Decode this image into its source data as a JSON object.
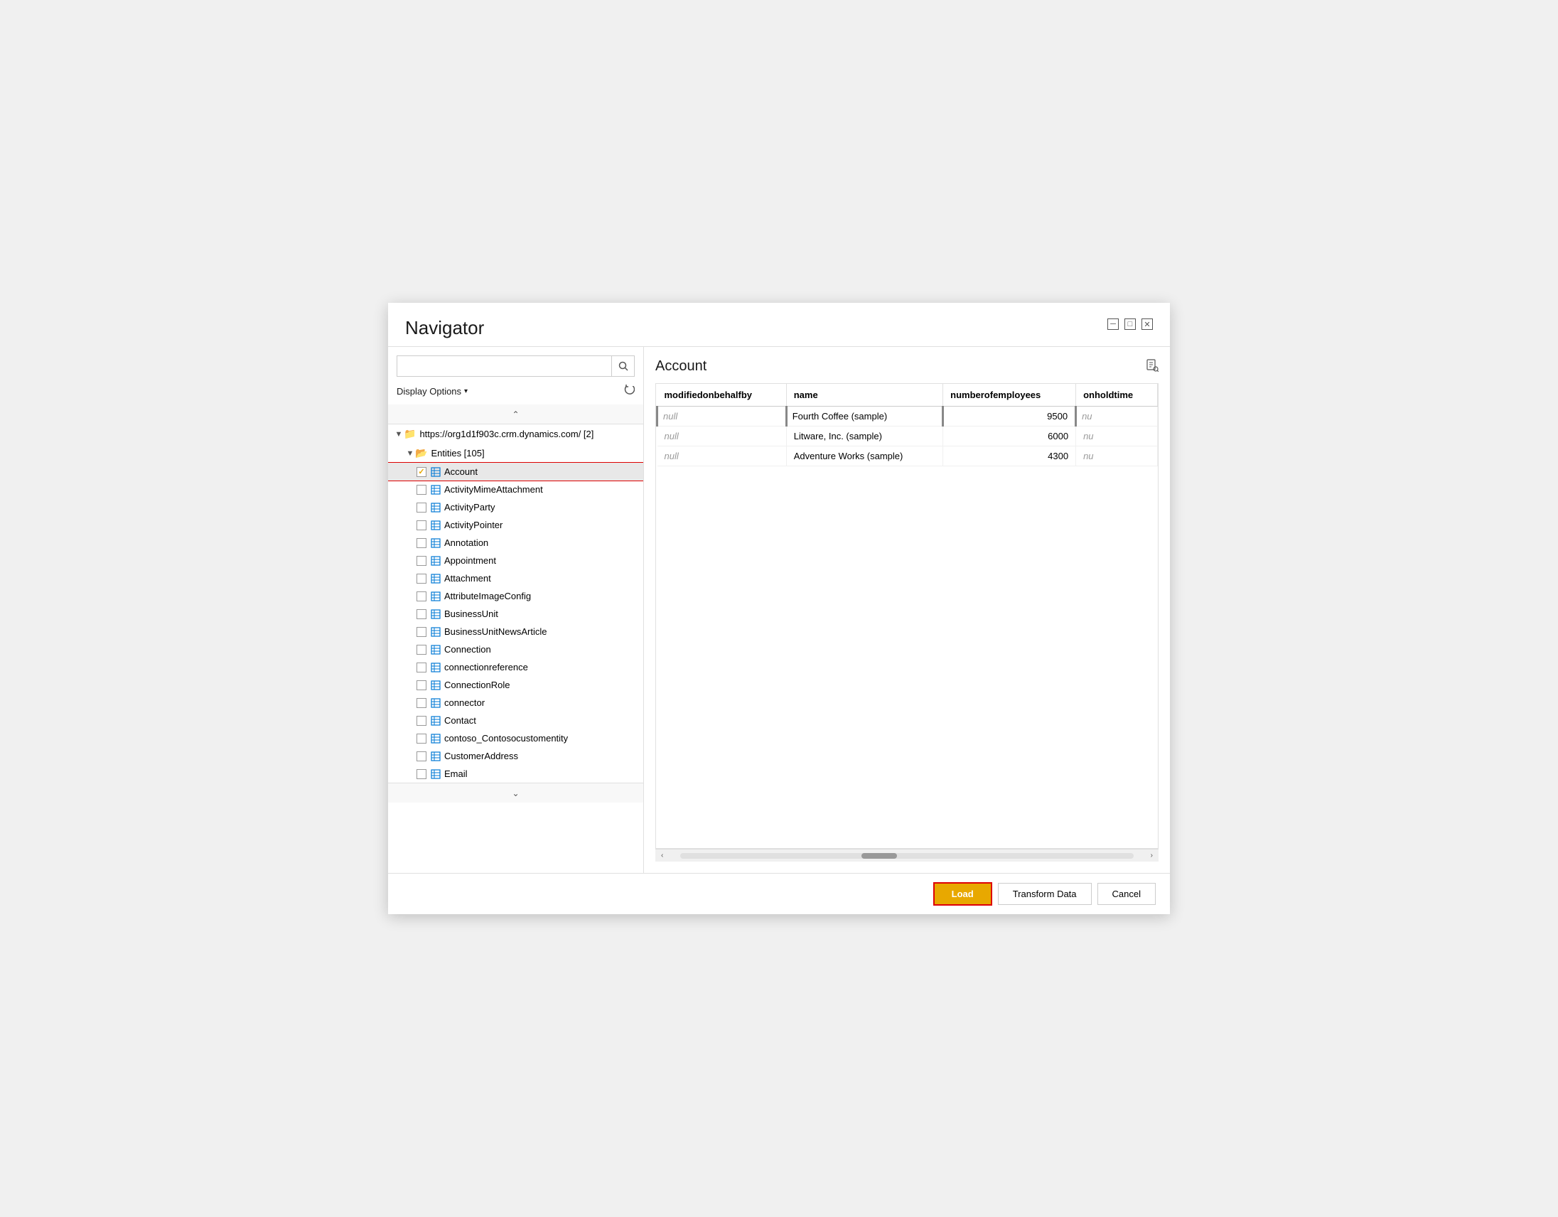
{
  "dialog": {
    "title": "Navigator"
  },
  "window_controls": {
    "minimize": "─",
    "maximize": "□",
    "close": "✕"
  },
  "left_panel": {
    "search_placeholder": "",
    "display_options_label": "Display Options",
    "tree": {
      "root_url": "https://org1d1f903c.crm.dynamics.com/ [2]",
      "entities_label": "Entities [105]",
      "items": [
        {
          "name": "Account",
          "checked": true
        },
        {
          "name": "ActivityMimeAttachment",
          "checked": false
        },
        {
          "name": "ActivityParty",
          "checked": false
        },
        {
          "name": "ActivityPointer",
          "checked": false
        },
        {
          "name": "Annotation",
          "checked": false
        },
        {
          "name": "Appointment",
          "checked": false
        },
        {
          "name": "Attachment",
          "checked": false
        },
        {
          "name": "AttributeImageConfig",
          "checked": false
        },
        {
          "name": "BusinessUnit",
          "checked": false
        },
        {
          "name": "BusinessUnitNewsArticle",
          "checked": false
        },
        {
          "name": "Connection",
          "checked": false
        },
        {
          "name": "connectionreference",
          "checked": false
        },
        {
          "name": "ConnectionRole",
          "checked": false
        },
        {
          "name": "connector",
          "checked": false
        },
        {
          "name": "Contact",
          "checked": false
        },
        {
          "name": "contoso_Contosocustomentity",
          "checked": false
        },
        {
          "name": "CustomerAddress",
          "checked": false
        },
        {
          "name": "Email",
          "checked": false
        }
      ]
    }
  },
  "right_panel": {
    "preview_title": "Account",
    "table": {
      "columns": [
        "modifiedonbehalfby",
        "name",
        "numberofemployees",
        "onholdtime"
      ],
      "rows": [
        {
          "modifiedonbehalfby": "null",
          "name": "Fourth Coffee (sample)",
          "numberofemployees": "9500",
          "onholdtime": "nu"
        },
        {
          "modifiedonbehalfby": "null",
          "name": "Litware, Inc. (sample)",
          "numberofemployees": "6000",
          "onholdtime": "nu"
        },
        {
          "modifiedonbehalfby": "null",
          "name": "Adventure Works (sample)",
          "numberofemployees": "4300",
          "onholdtime": "nu"
        }
      ]
    }
  },
  "footer": {
    "load_label": "Load",
    "transform_label": "Transform Data",
    "cancel_label": "Cancel"
  }
}
